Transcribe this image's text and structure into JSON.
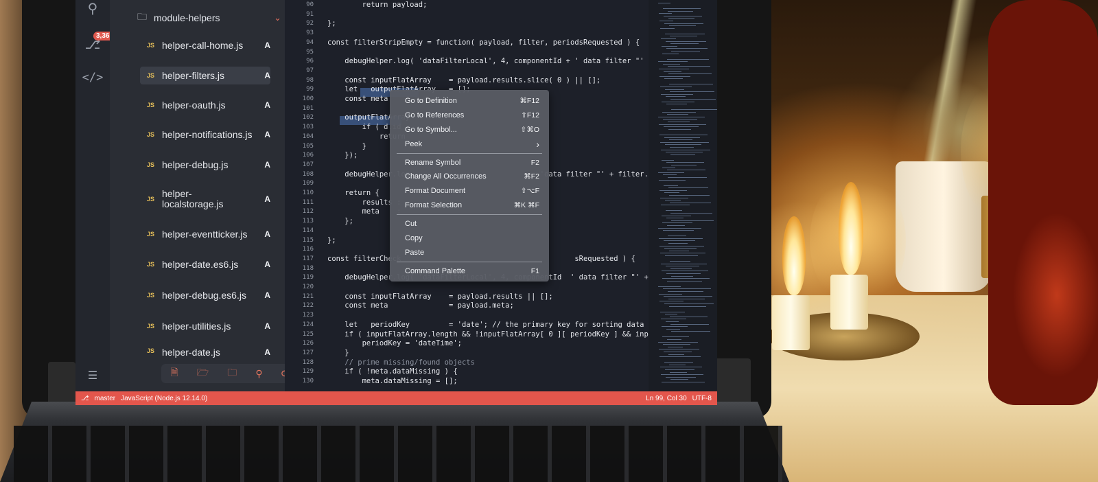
{
  "activitybar": {
    "badge": "3,363"
  },
  "sidebar": {
    "folder": "module-helpers",
    "files": [
      {
        "type": "JS",
        "name": "helper-call-home.js",
        "status": "A"
      },
      {
        "type": "JS",
        "name": "helper-filters.js",
        "status": "A"
      },
      {
        "type": "JS",
        "name": "helper-oauth.js",
        "status": "A"
      },
      {
        "type": "JS",
        "name": "helper-notifications.js",
        "status": "A"
      },
      {
        "type": "JS",
        "name": "helper-debug.js",
        "status": "A"
      },
      {
        "type": "JS",
        "name": "helper-\nlocalstorage.js",
        "status": "A"
      },
      {
        "type": "JS",
        "name": "helper-eventticker.js",
        "status": "A"
      },
      {
        "type": "JS",
        "name": "helper-date.es6.js",
        "status": "A"
      },
      {
        "type": "JS",
        "name": "helper-debug.es6.js",
        "status": "A"
      },
      {
        "type": "JS",
        "name": "helper-utilities.js",
        "status": "A"
      },
      {
        "type": "JS",
        "name": "helper-date.js",
        "status": "A"
      }
    ]
  },
  "editor": {
    "lines": [
      {
        "n": "90",
        "t": "        return payload;"
      },
      {
        "n": "91",
        "t": ""
      },
      {
        "n": "92",
        "t": "};"
      },
      {
        "n": "93",
        "t": ""
      },
      {
        "n": "94",
        "t": "const filterStripEmpty = function( payload, filter, periodsRequested ) {"
      },
      {
        "n": "95",
        "t": ""
      },
      {
        "n": "96",
        "t": "    debugHelper.log( 'dataFilterLocal', 4, componentId + ' data filter \"' + filter.fi"
      },
      {
        "n": "97",
        "t": ""
      },
      {
        "n": "98",
        "t": "    const inputFlatArray    = payload.results.slice( 0 ) || [];"
      },
      {
        "n": "99",
        "t": "    let   outputFlatArray   = [];"
      },
      {
        "n": "100",
        "t": "    const meta"
      },
      {
        "n": "101",
        "t": ""
      },
      {
        "n": "102",
        "t": "    outputFlatArray"
      },
      {
        "n": "103",
        "t": "        if ( d.id"
      },
      {
        "n": "104",
        "t": "            return"
      },
      {
        "n": "105",
        "t": "        }"
      },
      {
        "n": "106",
        "t": "    });"
      },
      {
        "n": "107",
        "t": ""
      },
      {
        "n": "108",
        "t": "    debugHelper.log                              'data filter \"' + filter.fi"
      },
      {
        "n": "109",
        "t": ""
      },
      {
        "n": "110",
        "t": "    return {"
      },
      {
        "n": "111",
        "t": "        results :"
      },
      {
        "n": "112",
        "t": "        meta    :"
      },
      {
        "n": "113",
        "t": "    };"
      },
      {
        "n": "114",
        "t": ""
      },
      {
        "n": "115",
        "t": "};"
      },
      {
        "n": "116",
        "t": ""
      },
      {
        "n": "117",
        "t": "const filterCheck                                        sRequested ) {"
      },
      {
        "n": "118",
        "t": ""
      },
      {
        "n": "119",
        "t": "    debugHelper.log( 'dataFilterLocal', 4, componentId  ' data filter \"' + filter.fi"
      },
      {
        "n": "120",
        "t": ""
      },
      {
        "n": "121",
        "t": "    const inputFlatArray    = payload.results || [];"
      },
      {
        "n": "122",
        "t": "    const meta              = payload.meta;"
      },
      {
        "n": "123",
        "t": ""
      },
      {
        "n": "124",
        "t": "    let   periodKey         = 'date'; // the primary key for sorting data (every dbst"
      },
      {
        "n": "125",
        "t": "    if ( inputFlatArray.length && !inputFlatArray[ 0 ][ periodKey ] && inputFlatArray"
      },
      {
        "n": "126",
        "t": "        periodKey = 'dateTime';"
      },
      {
        "n": "127",
        "t": "    }"
      },
      {
        "n": "128",
        "t": "    // prime missing/found objects"
      },
      {
        "n": "129",
        "t": "    if ( !meta.dataMissing ) {"
      },
      {
        "n": "130",
        "t": "        meta.dataMissing = [];"
      }
    ]
  },
  "context_menu": {
    "groups": [
      [
        {
          "label": "Go to Definition",
          "shortcut": "⌘F12"
        },
        {
          "label": "Go to References",
          "shortcut": "⇧F12"
        },
        {
          "label": "Go to Symbol...",
          "shortcut": "⇧⌘O"
        },
        {
          "label": "Peek",
          "shortcut": "›"
        }
      ],
      [
        {
          "label": "Rename Symbol",
          "shortcut": "F2"
        },
        {
          "label": "Change All Occurrences",
          "shortcut": "⌘F2"
        },
        {
          "label": "Format Document",
          "shortcut": "⇧⌥F"
        },
        {
          "label": "Format Selection",
          "shortcut": "⌘K ⌘F"
        }
      ],
      [
        {
          "label": "Cut",
          "shortcut": ""
        },
        {
          "label": "Copy",
          "shortcut": ""
        },
        {
          "label": "Paste",
          "shortcut": ""
        }
      ],
      [
        {
          "label": "Command Palette",
          "shortcut": "F1"
        }
      ]
    ]
  },
  "statusbar": {
    "branch": "master",
    "language": "JavaScript (Node.js 12.14.0)",
    "position": "Ln 99, Col 30",
    "encoding": "UTF-8"
  },
  "colors": {
    "accent": "#e3564c",
    "js_badge": "#e8c15a"
  }
}
